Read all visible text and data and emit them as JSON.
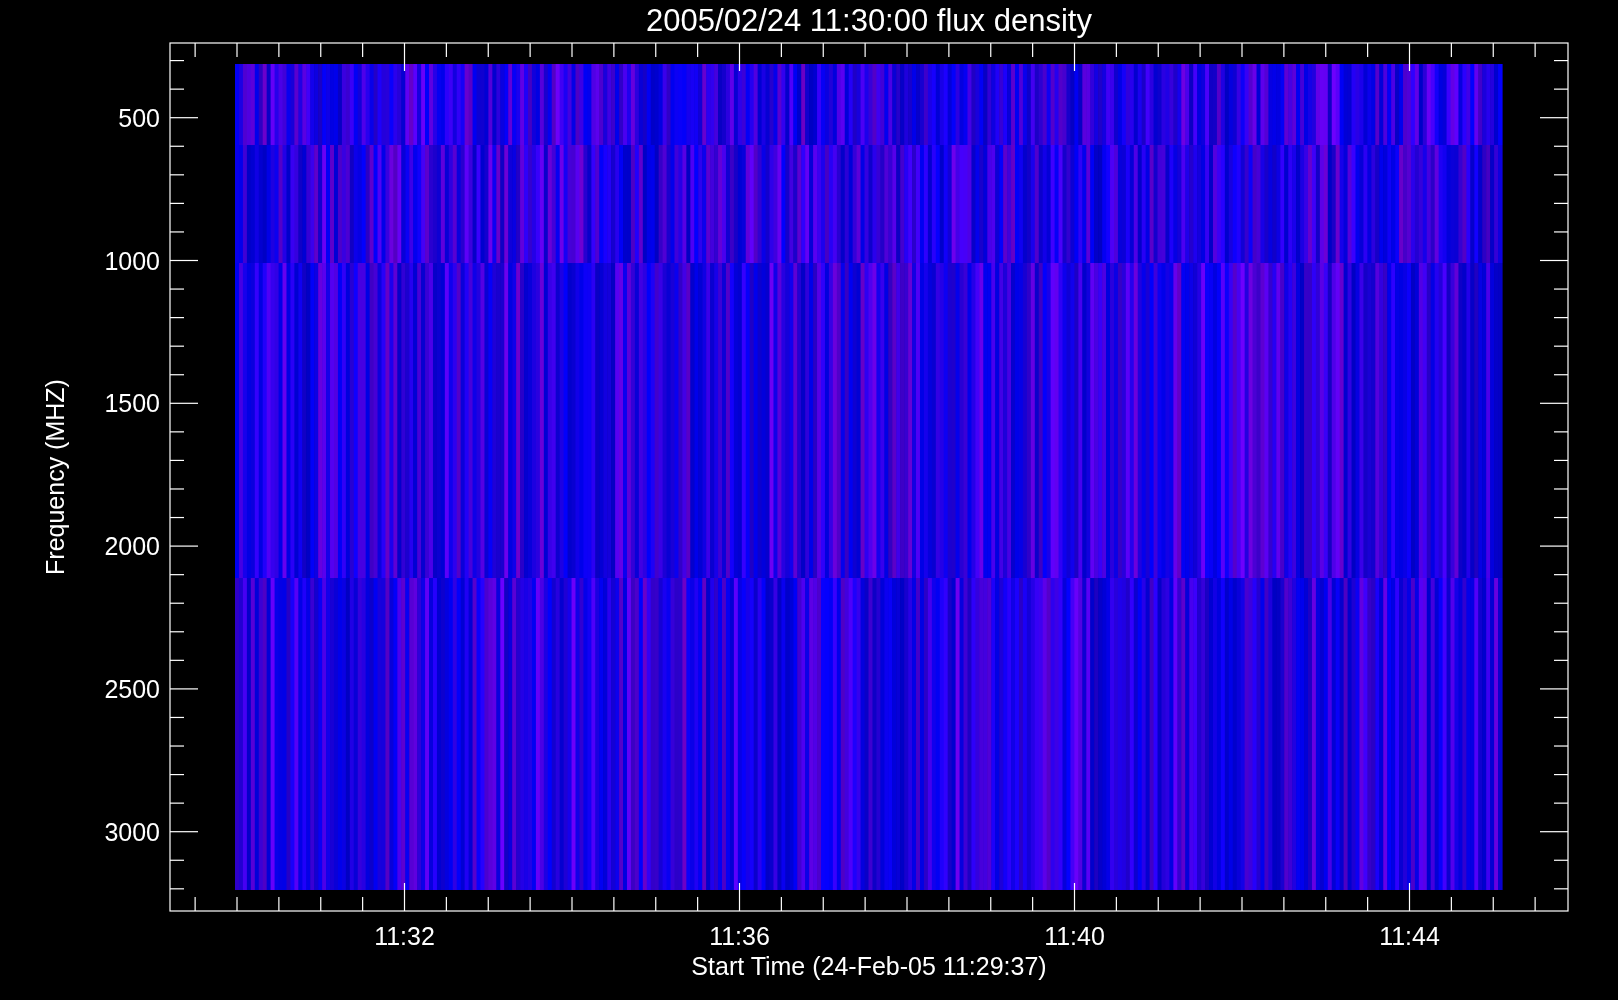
{
  "title": "2005/02/24 11:30:00 flux density",
  "y_axis": {
    "label": "Frequency (MHZ)",
    "ticks": [
      "500",
      "1000",
      "1500",
      "2000",
      "2500",
      "3000"
    ]
  },
  "x_axis": {
    "label": "Start Time (24-Feb-05 11:29:37)",
    "ticks": [
      "11:32",
      "11:36",
      "11:40",
      "11:44"
    ]
  }
}
